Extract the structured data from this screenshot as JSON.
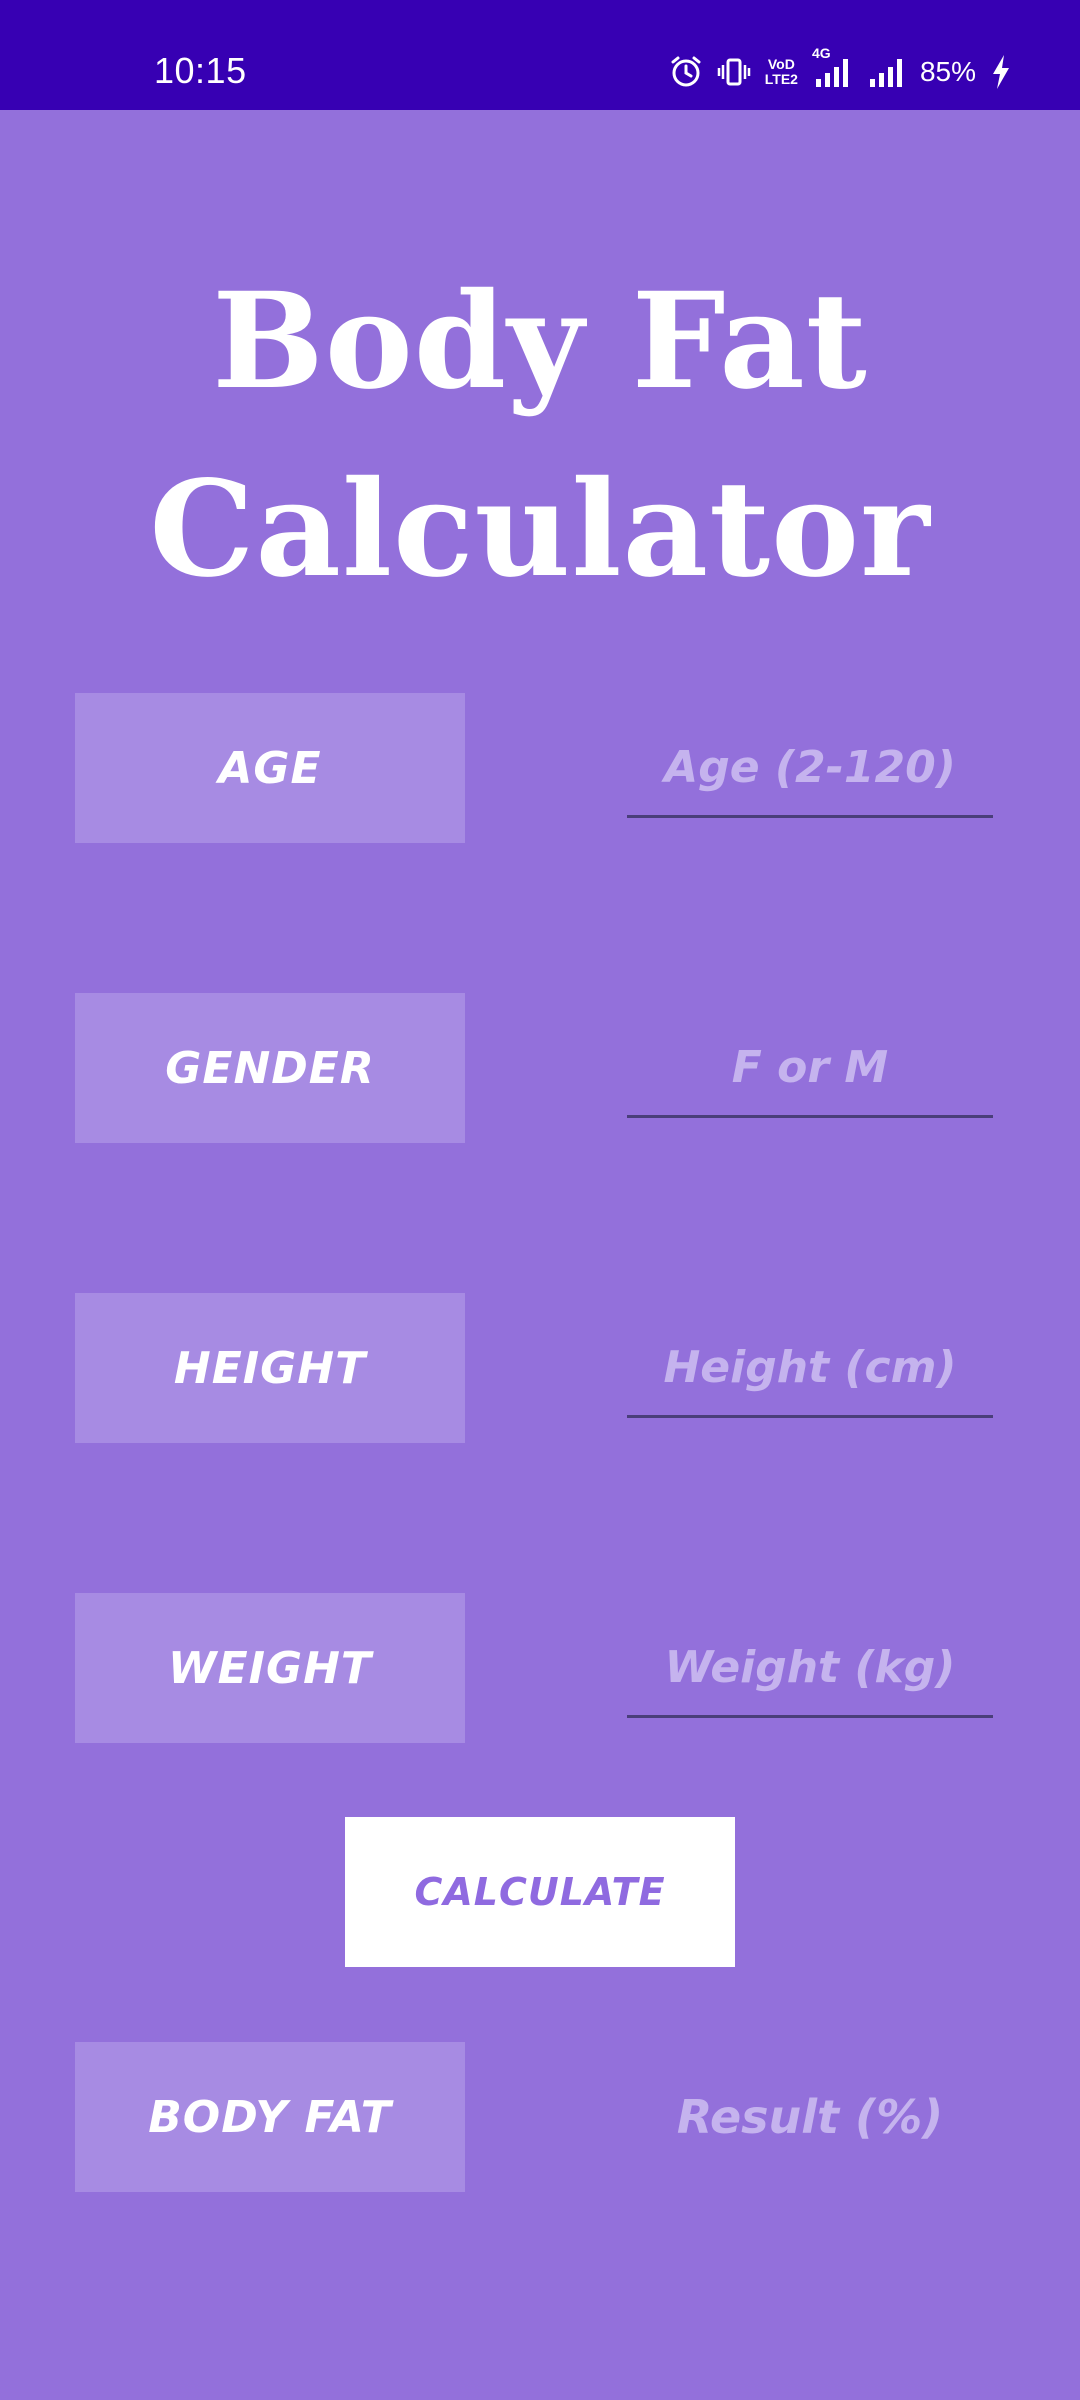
{
  "status_bar": {
    "time": "10:15",
    "volte_top": "VoD",
    "volte_bottom": "LTE2",
    "network": "4G",
    "battery": "85%",
    "icons": [
      "alarm-icon",
      "vibrate-icon",
      "volte-icon",
      "signal-4g-icon",
      "signal-icon",
      "charging-icon"
    ]
  },
  "app": {
    "title_line1": "Body Fat",
    "title_line2": "Calculator"
  },
  "form": {
    "age_label": "AGE",
    "age_placeholder": "Age (2-120)",
    "gender_label": "GENDER",
    "gender_placeholder": "F or M",
    "height_label": "HEIGHT",
    "height_placeholder": "Height (cm)",
    "weight_label": "WEIGHT",
    "weight_placeholder": "Weight (kg)",
    "calculate_label": "CALCULATE",
    "bodyfat_label": "BODY FAT",
    "result_placeholder": "Result (%)"
  },
  "colors": {
    "background": "#9370DB",
    "status_bar": "#3700B3",
    "label_box": "#A78BE3",
    "button_text": "#8F6AE0",
    "hint_text": "#C5B3EE"
  }
}
